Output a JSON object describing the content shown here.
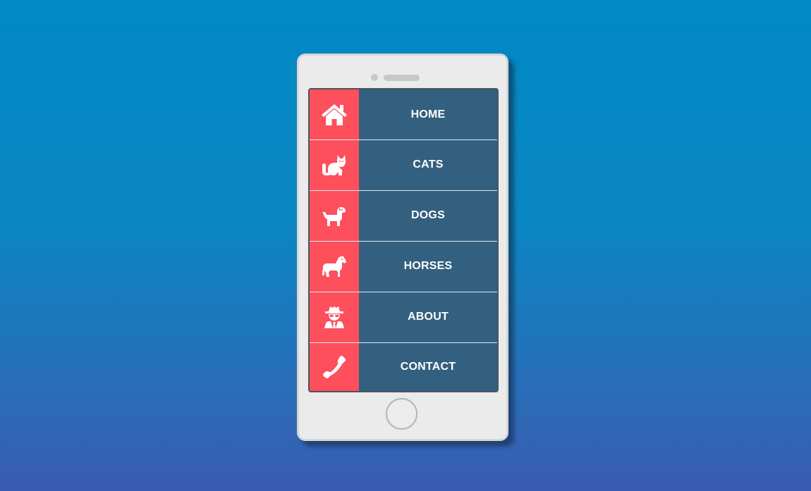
{
  "colors": {
    "background_top": "#0089c4",
    "background_bottom": "#3a5bb0",
    "menu_bg": "#33607f",
    "icon_bg": "#fd4f5c",
    "label_text": "#ffffff",
    "phone_body": "#ebebeb"
  },
  "menu": {
    "items": [
      {
        "label": "HOME",
        "icon": "home-icon"
      },
      {
        "label": "CATS",
        "icon": "cat-icon"
      },
      {
        "label": "DOGS",
        "icon": "dog-icon"
      },
      {
        "label": "HORSES",
        "icon": "horse-icon"
      },
      {
        "label": "ABOUT",
        "icon": "user-secret-icon"
      },
      {
        "label": "CONTACT",
        "icon": "phone-icon"
      }
    ]
  }
}
